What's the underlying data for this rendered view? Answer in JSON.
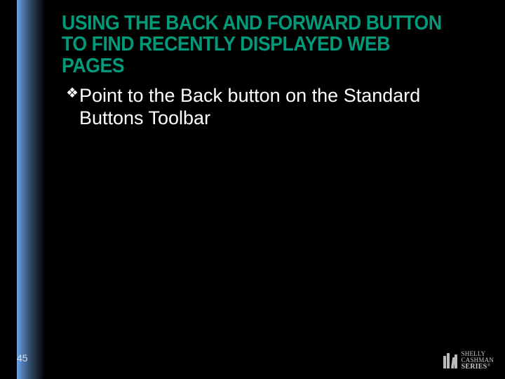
{
  "slide": {
    "title": "USING THE BACK AND FORWARD BUTTON TO FIND RECENTLY DISPLAYED WEB PAGES",
    "bullet": {
      "marker": "❖",
      "text": "Point to the Back button on the Standard Buttons Toolbar"
    },
    "number": "45"
  },
  "brand": {
    "line1": "SHELLY",
    "line2": "CASHMAN",
    "line3": "SERIES",
    "tm": "®"
  }
}
